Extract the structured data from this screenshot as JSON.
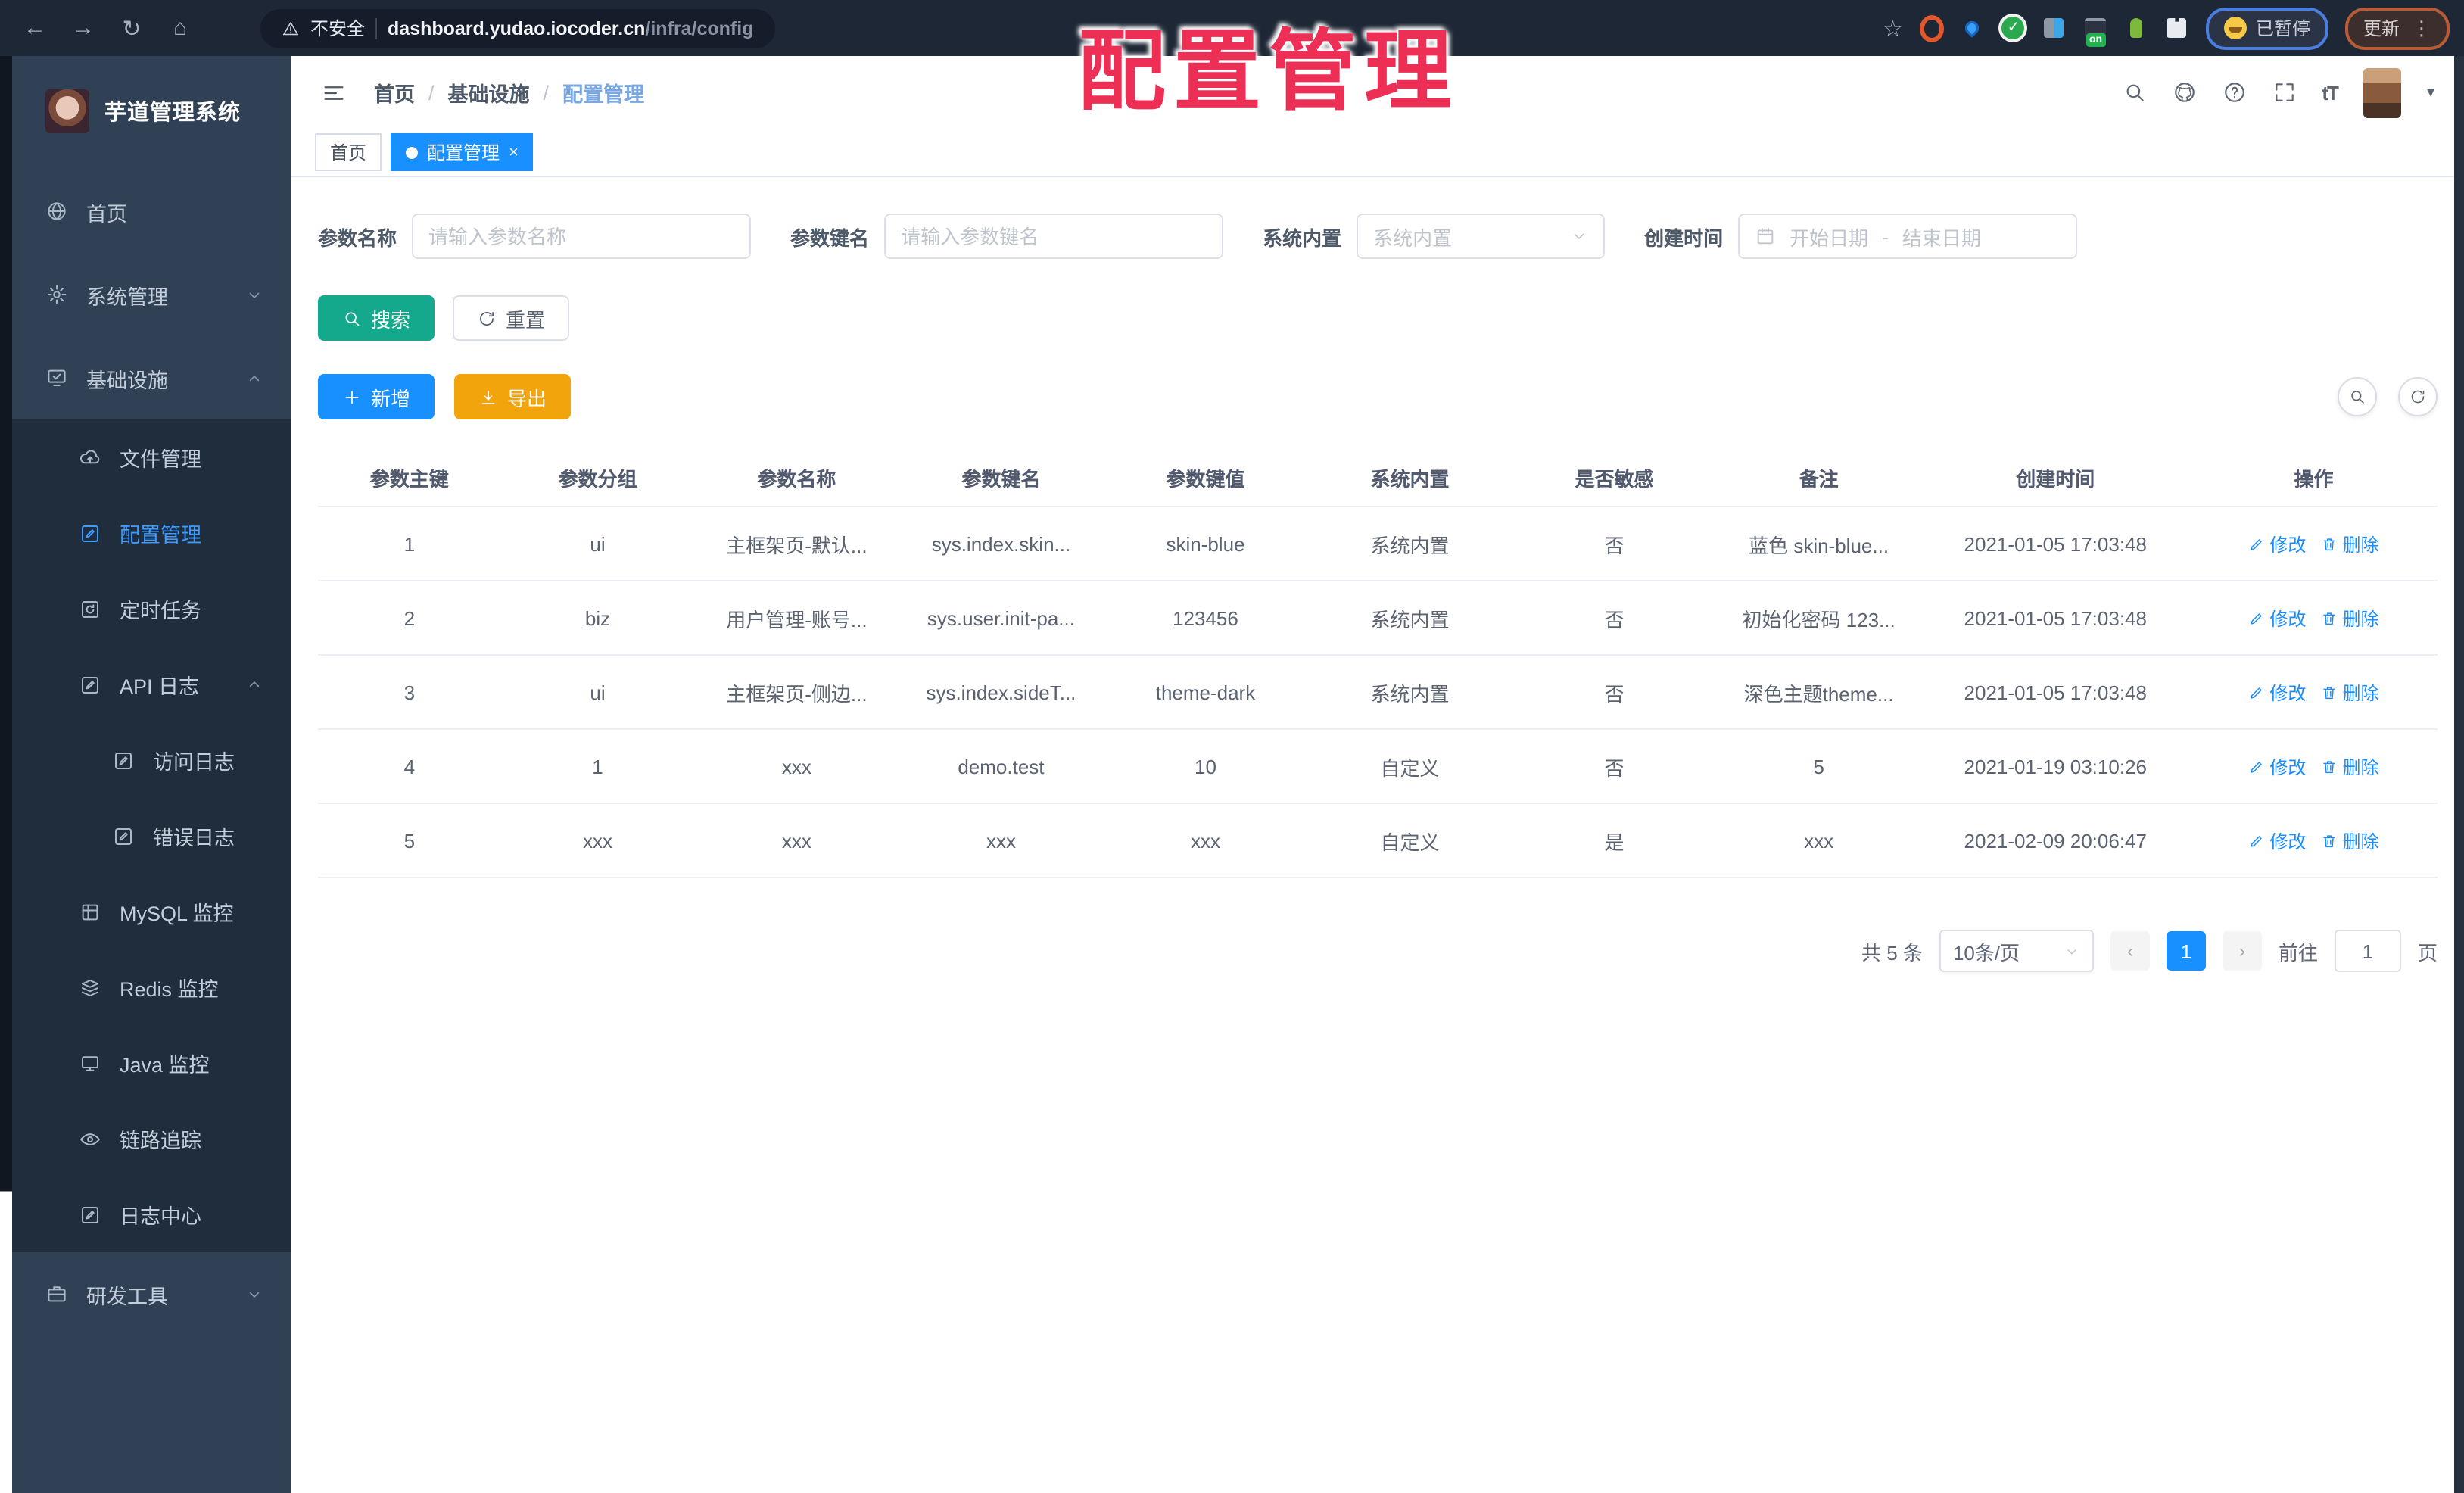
{
  "browser": {
    "security_label": "不安全",
    "url_host": "dashboard.yudao.iocoder.cn",
    "url_path": "/infra/config",
    "nav_icons": [
      "back-icon",
      "forward-icon",
      "reload-icon",
      "home-icon"
    ],
    "extensions": [
      {
        "icon": "orange-ring-extension-icon"
      },
      {
        "icon": "pin-extension-icon"
      },
      {
        "icon": "green-check-extension-icon"
      },
      {
        "icon": "grid-extension-icon"
      },
      {
        "icon": "terminal-extension-icon",
        "badge": "on"
      },
      {
        "icon": "sprout-extension-icon"
      },
      {
        "icon": "puzzle-extension-icon"
      }
    ],
    "paused_badge": "已暂停",
    "update_button": "更新"
  },
  "watermark": "配置管理",
  "sidebar": {
    "title": "芋道管理系统",
    "items": [
      {
        "id": "home",
        "label": "首页",
        "icon": "home-icon",
        "depth": 0
      },
      {
        "id": "system",
        "label": "系统管理",
        "icon": "gear-icon",
        "depth": 0,
        "chevron": "down"
      },
      {
        "id": "infra",
        "label": "基础设施",
        "icon": "infra-icon",
        "depth": 0,
        "chevron": "up"
      },
      {
        "id": "file",
        "label": "文件管理",
        "icon": "cloud-icon",
        "depth": 1
      },
      {
        "id": "config",
        "label": "配置管理",
        "icon": "edit-square-icon",
        "depth": 1,
        "active": true
      },
      {
        "id": "job",
        "label": "定时任务",
        "icon": "timer-icon",
        "depth": 1
      },
      {
        "id": "api-log",
        "label": "API 日志",
        "icon": "edit-square-icon",
        "depth": 1,
        "chevron": "up"
      },
      {
        "id": "access-log",
        "label": "访问日志",
        "icon": "edit-square-icon",
        "depth": 2
      },
      {
        "id": "error-log",
        "label": "错误日志",
        "icon": "edit-square-icon",
        "depth": 2
      },
      {
        "id": "mysql",
        "label": "MySQL 监控",
        "icon": "mysql-icon",
        "depth": 1
      },
      {
        "id": "redis",
        "label": "Redis 监控",
        "icon": "redis-icon",
        "depth": 1
      },
      {
        "id": "java",
        "label": "Java 监控",
        "icon": "java-icon",
        "depth": 1
      },
      {
        "id": "trace",
        "label": "链路追踪",
        "icon": "eye-icon",
        "depth": 1
      },
      {
        "id": "log-center",
        "label": "日志中心",
        "icon": "edit-square-icon",
        "depth": 1
      },
      {
        "id": "dev-tools",
        "label": "研发工具",
        "icon": "briefcase-icon",
        "depth": 0,
        "chevron": "down"
      }
    ]
  },
  "header": {
    "breadcrumb": [
      "首页",
      "基础设施",
      "配置管理"
    ],
    "icons": [
      "search-icon",
      "github-icon",
      "help-icon",
      "fullscreen-icon",
      "font-size-icon"
    ]
  },
  "tabs": [
    {
      "label": "首页",
      "active": false
    },
    {
      "label": "配置管理",
      "active": true,
      "closable": true
    }
  ],
  "filters": {
    "name": {
      "label": "参数名称",
      "placeholder": "请输入参数名称"
    },
    "key": {
      "label": "参数键名",
      "placeholder": "请输入参数键名"
    },
    "type": {
      "label": "系统内置",
      "placeholder": "系统内置"
    },
    "date": {
      "label": "创建时间",
      "start": "开始日期",
      "separator": "-",
      "end": "结束日期"
    }
  },
  "actions": {
    "search": "搜索",
    "reset": "重置",
    "add": "新增",
    "export": "导出"
  },
  "table": {
    "columns": [
      "参数主键",
      "参数分组",
      "参数名称",
      "参数键名",
      "参数键值",
      "系统内置",
      "是否敏感",
      "备注",
      "创建时间",
      "操作"
    ],
    "rows": [
      [
        "1",
        "ui",
        "主框架页-默认...",
        "sys.index.skin...",
        "skin-blue",
        "系统内置",
        "否",
        "蓝色 skin-blue...",
        "2021-01-05 17:03:48"
      ],
      [
        "2",
        "biz",
        "用户管理-账号...",
        "sys.user.init-pa...",
        "123456",
        "系统内置",
        "否",
        "初始化密码 123...",
        "2021-01-05 17:03:48"
      ],
      [
        "3",
        "ui",
        "主框架页-侧边...",
        "sys.index.sideT...",
        "theme-dark",
        "系统内置",
        "否",
        "深色主题theme...",
        "2021-01-05 17:03:48"
      ],
      [
        "4",
        "1",
        "xxx",
        "demo.test",
        "10",
        "自定义",
        "否",
        "5",
        "2021-01-19 03:10:26"
      ],
      [
        "5",
        "xxx",
        "xxx",
        "xxx",
        "xxx",
        "自定义",
        "是",
        "xxx",
        "2021-02-09 20:06:47"
      ]
    ],
    "row_actions": {
      "edit": {
        "label": "修改",
        "icon": "pencil-icon"
      },
      "delete": {
        "label": "删除",
        "icon": "trash-icon"
      }
    }
  },
  "pagination": {
    "total": "共 5 条",
    "page_size": "10条/页",
    "current_page": "1",
    "goto_label": "前往",
    "goto_value": "1",
    "page_unit": "页"
  },
  "colors": {
    "accent": "#1890ff",
    "success": "#14a98c",
    "warning": "#f1a40c",
    "watermark_red": "#ee2f55",
    "sidebar_bg": "#304156",
    "submenu_bg": "#1f2d3d",
    "chrome_bg": "#1e2735"
  }
}
